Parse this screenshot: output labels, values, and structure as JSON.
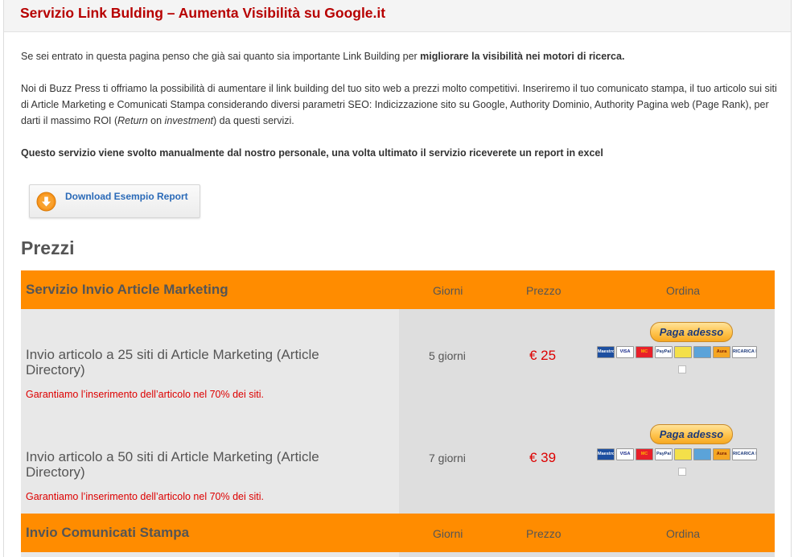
{
  "page": {
    "title": "Servizio Link Bulding – Aumenta Visibilità su Google.it"
  },
  "intro": {
    "p1_prefix": "Se sei entrato in questa pagina penso che già sai quanto sia importante Link Building per ",
    "p1_bold": "migliorare la visibilità nei motori di ricerca.",
    "p2_part1": "Noi di Buzz Press ti offriamo la possibilità di aumentare il link building del tuo sito web a prezzi molto competitivi. Inseriremo il tuo comunicato stampa, il tuo articolo sui siti di Article Marketing e Comunicati Stampa considerando diversi parametri SEO: Indicizzazione sito su Google, Authority Dominio, Authority Pagina web (Page Rank), per darti il massimo ROI (",
    "p2_italic1": "Return",
    "p2_part2": " on ",
    "p2_italic2": "investment",
    "p2_part3": ") da questi servizi.",
    "p3": "Questo servizio viene svolto manualmente dal nostro personale, una volta ultimato il servizio riceverete un report in excel"
  },
  "download": {
    "label": "Download Esempio Report"
  },
  "pricing": {
    "heading": "Prezzi",
    "sections": [
      {
        "title": "Servizio Invio Article Marketing",
        "col_days": "Giorni",
        "col_price": "Prezzo",
        "col_order": "Ordina",
        "rows": [
          {
            "name": "Invio articolo a 25 siti di Article Marketing (Article Directory)",
            "note": "Garantiamo l’inserimento dell’articolo nel 70% dei siti.",
            "days": "5 giorni",
            "price": "€ 25",
            "pay_label": "Paga adesso"
          },
          {
            "name": "Invio articolo a 50 siti di Article Marketing (Article Directory)",
            "note": "Garantiamo l’inserimento dell’articolo nel 70% dei siti.",
            "days": "7 giorni",
            "price": "€ 39",
            "pay_label": "Paga adesso"
          }
        ]
      },
      {
        "title": "Invio Comunicati Stampa",
        "col_days": "Giorni",
        "col_price": "Prezzo",
        "col_order": "Ordina"
      }
    ]
  },
  "payment_cards": [
    {
      "name": "maestro-card-icon",
      "text": "Maestro",
      "bg": "#1d4fa0",
      "fg": "#ffffff"
    },
    {
      "name": "visa-card-icon",
      "text": "VISA",
      "bg": "#ffffff",
      "fg": "#1a2b8c"
    },
    {
      "name": "mastercard-card-icon",
      "text": "MC",
      "bg": "#e8202a",
      "fg": "#ffb400"
    },
    {
      "name": "paypal-card-icon",
      "text": "PayPal",
      "bg": "#ffffff",
      "fg": "#1d3a7a"
    },
    {
      "name": "postepay-card-icon",
      "text": "",
      "bg": "#f4e04a",
      "fg": "#333333"
    },
    {
      "name": "amex-card-icon",
      "text": "",
      "bg": "#5ba3d9",
      "fg": "#ffffff"
    },
    {
      "name": "aura-card-icon",
      "text": "Aura",
      "bg": "#f5a623",
      "fg": "#7a1a00"
    },
    {
      "name": "ricarica-paypal-card-icon",
      "text": "RICARICA PAYPAL",
      "bg": "#ffffff",
      "fg": "#1d3a7a"
    }
  ],
  "colors": {
    "accent": "#ff8c00",
    "title": "#b70000",
    "price": "#dd0000",
    "link": "#2a6ab8"
  }
}
